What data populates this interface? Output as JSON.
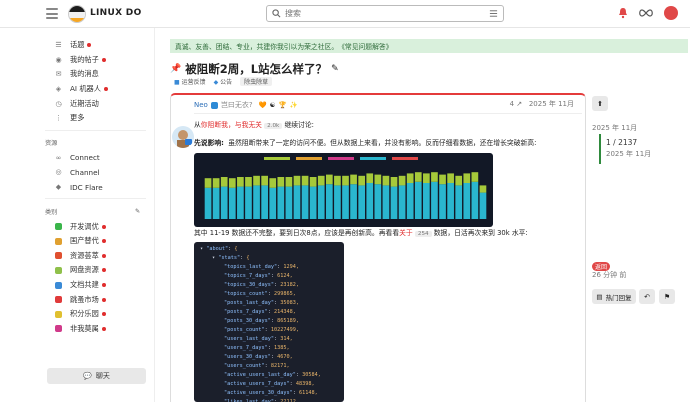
{
  "header": {
    "brand": "LINUX DO",
    "search_placeholder": "搜索"
  },
  "sidebar": {
    "items": [
      {
        "label": "话题",
        "icon": "topics-icon",
        "dot": true
      },
      {
        "label": "我的帖子",
        "icon": "user-icon",
        "dot": true
      },
      {
        "label": "我的消息",
        "icon": "inbox-icon",
        "dot": false
      },
      {
        "label": "AI 机器人",
        "icon": "robot-icon",
        "dot": true
      },
      {
        "label": "近期活动",
        "icon": "activity-icon",
        "dot": false
      },
      {
        "label": "更多",
        "icon": "more-icon",
        "dot": false
      }
    ],
    "section1": "资源",
    "resources": [
      {
        "label": "Connect",
        "icon": "link-icon"
      },
      {
        "label": "Channel",
        "icon": "channel-icon"
      },
      {
        "label": "IDC Flare",
        "icon": "flare-icon"
      }
    ],
    "section2": "类别",
    "categories": [
      {
        "label": "开发调优",
        "color": "#3ab54a",
        "dot": true
      },
      {
        "label": "国产替代",
        "color": "#e0a030",
        "dot": true
      },
      {
        "label": "资源荟萃",
        "color": "#e05030",
        "dot": true
      },
      {
        "label": "网盘资源",
        "color": "#8fc04a",
        "dot": true
      },
      {
        "label": "文档共建",
        "color": "#3a8ad6",
        "dot": true
      },
      {
        "label": "跳蚤市场",
        "color": "#e03a3a",
        "dot": true
      },
      {
        "label": "积分乐园",
        "color": "#e0c030",
        "dot": true
      },
      {
        "label": "非我莫属",
        "color": "#d03a8a",
        "dot": true
      }
    ],
    "chat_label": "聊天"
  },
  "banner": {
    "text": "真诚、友善、团结、专业，共建你我引以为荣之社区。",
    "link": "《常见问题解答》"
  },
  "topic": {
    "title": "被阻断2周，L站怎么样了？",
    "tags": [
      "运营反馈",
      "公告",
      "除虫除草"
    ]
  },
  "post": {
    "username": "Neo",
    "user_title": "岂曰无衣?",
    "reply_count": "4",
    "date": "2025 年 11月",
    "line1_prefix": "从",
    "line1_link": "你阻断我，与我无关",
    "line1_badge": "2.0k",
    "line1_suffix": "继续讨论:",
    "line2_bold": "先说影响:",
    "line2_text": "虽然阻断带来了一定的访问不便。但从数据上来看，并没有影响。反而仔细看数据，还在增长突破新高:",
    "line3_prefix": "其中 11-19 数据还不完整，要到日次8点，应该是再创新高。再看看",
    "line3_link": "关于",
    "line3_badge": "254",
    "line3_suffix": "数据，日活再次来到 30k 水平:"
  },
  "code": {
    "lines": [
      {
        "k": "\"about\"",
        "v": "{",
        "indent": 0
      },
      {
        "k": "\"stats\"",
        "v": "{",
        "indent": 1
      },
      {
        "k": "\"topics_last_day\"",
        "v": "1294,",
        "indent": 2
      },
      {
        "k": "\"topics_7_days\"",
        "v": "6124,",
        "indent": 2
      },
      {
        "k": "\"topics_30_days\"",
        "v": "23182,",
        "indent": 2
      },
      {
        "k": "\"topics_count\"",
        "v": "299865,",
        "indent": 2
      },
      {
        "k": "\"posts_last_day\"",
        "v": "35083,",
        "indent": 2
      },
      {
        "k": "\"posts_7_days\"",
        "v": "214348,",
        "indent": 2
      },
      {
        "k": "\"posts_30_days\"",
        "v": "865189,",
        "indent": 2
      },
      {
        "k": "\"posts_count\"",
        "v": "10227499,",
        "indent": 2
      },
      {
        "k": "\"users_last_day\"",
        "v": "314,",
        "indent": 2
      },
      {
        "k": "\"users_7_days\"",
        "v": "1385,",
        "indent": 2
      },
      {
        "k": "\"users_30_days\"",
        "v": "4670,",
        "indent": 2
      },
      {
        "k": "\"users_count\"",
        "v": "82171,",
        "indent": 2
      },
      {
        "k": "\"active_users_last_day\"",
        "v": "30584,",
        "indent": 2
      },
      {
        "k": "\"active_users_7_days\"",
        "v": "48398,",
        "indent": 2
      },
      {
        "k": "\"active_users_30_days\"",
        "v": "61148,",
        "indent": 2
      },
      {
        "k": "\"likes_last_day\"",
        "v": "22112",
        "indent": 2
      }
    ]
  },
  "timeline": {
    "date_top": "2025 年 11月",
    "count": "1 / 2137",
    "count_date": "2025 年 11月",
    "pill": "返回",
    "ago": "26 分钟 前",
    "hot_label": "热门回复"
  },
  "chart_data": {
    "type": "bar",
    "title": "",
    "series": [
      {
        "name": "",
        "color": "#2ab6cf",
        "values": [
          26,
          26,
          27,
          26,
          27,
          27,
          28,
          28,
          26,
          27,
          27,
          28,
          28,
          27,
          28,
          29,
          28,
          28,
          29,
          28,
          30,
          29,
          28,
          27,
          28,
          30,
          31,
          30,
          31,
          29,
          30,
          28,
          30,
          31,
          22
        ]
      },
      {
        "name": "",
        "color": "#a6c93a",
        "values": [
          8,
          8,
          8,
          8,
          8,
          8,
          8,
          8,
          8,
          8,
          8,
          8,
          8,
          8,
          8,
          8,
          8,
          8,
          8,
          8,
          8,
          8,
          8,
          8,
          8,
          8,
          8,
          8,
          8,
          8,
          8,
          8,
          8,
          8,
          6
        ]
      }
    ],
    "legend_colors": [
      "#a6c93a",
      "#e0a030",
      "#d03a8a",
      "#2ab6cf",
      "#e04848"
    ]
  }
}
